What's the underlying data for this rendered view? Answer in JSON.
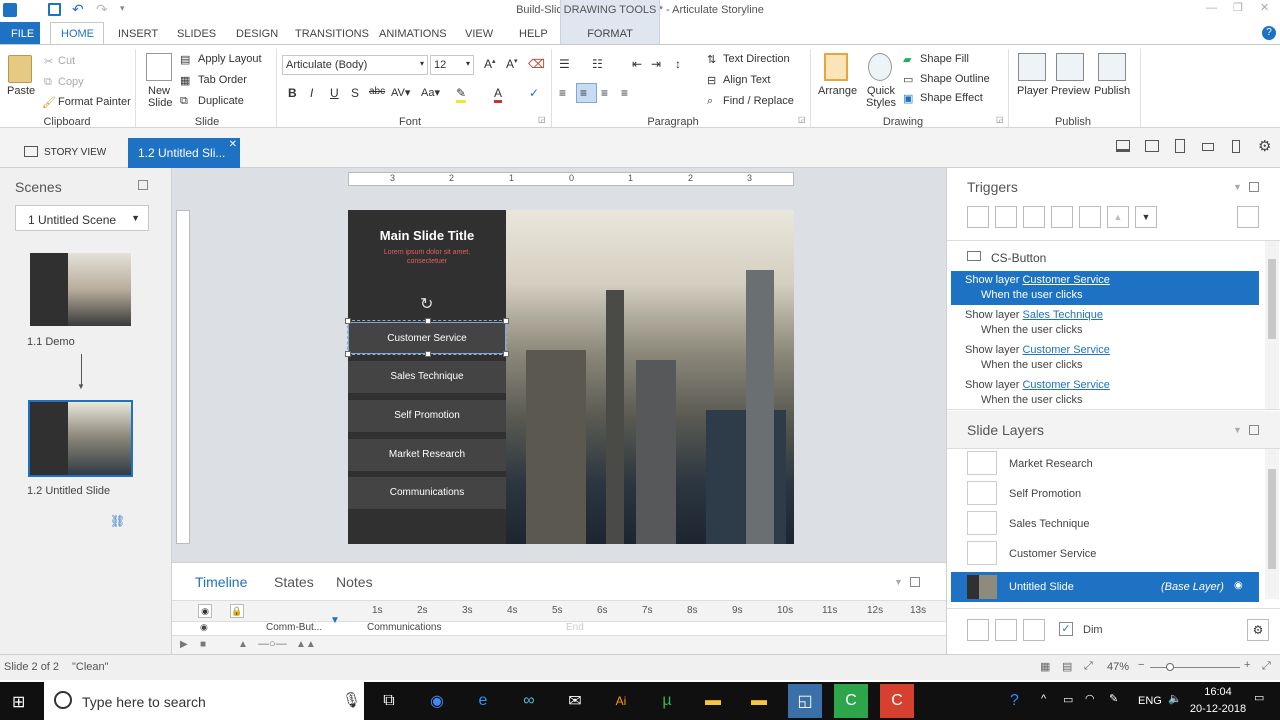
{
  "window": {
    "title": "Build-Slide-With-Trigger.story* - Articulate Storyline"
  },
  "drawing_tools": {
    "label": "DRAWING TOOLS",
    "format_tab": "FORMAT"
  },
  "tabs": {
    "file": "FILE",
    "home": "HOME",
    "insert": "INSERT",
    "slides": "SLIDES",
    "design": "DESIGN",
    "transitions": "TRANSITIONS",
    "animations": "ANIMATIONS",
    "view": "VIEW",
    "help": "HELP"
  },
  "ribbon": {
    "clipboard": {
      "paste": "Paste",
      "cut": "Cut",
      "copy": "Copy",
      "format_painter": "Format Painter",
      "group": "Clipboard"
    },
    "slide": {
      "new_slide": "New Slide",
      "apply_layout": "Apply Layout",
      "tab_order": "Tab Order",
      "duplicate": "Duplicate",
      "group": "Slide"
    },
    "font": {
      "family": "Articulate (Body)",
      "size": "12",
      "group": "Font"
    },
    "paragraph": {
      "text_direction": "Text Direction",
      "align_text": "Align Text",
      "find_replace": "Find / Replace",
      "group": "Paragraph"
    },
    "drawing": {
      "arrange": "Arrange",
      "quick_styles": "Quick Styles",
      "shape_fill": "Shape Fill",
      "shape_outline": "Shape Outline",
      "shape_effect": "Shape Effect",
      "group": "Drawing"
    },
    "publish": {
      "player": "Player",
      "preview": "Preview",
      "publish": "Publish",
      "group": "Publish"
    }
  },
  "viewtabs": {
    "story_view": "STORY VIEW",
    "slide_tab": "1.2 Untitled Sli..."
  },
  "scenes": {
    "title": "Scenes",
    "dropdown": "1 Untitled Scene",
    "items": [
      {
        "label": "1.1 Demo"
      },
      {
        "label": "1.2 Untitled Slide"
      }
    ]
  },
  "slide": {
    "title": "Main Slide Title",
    "subtitle": "Lorem ipsum dolor sit amet, consectetuer",
    "buttons": [
      "Customer Service",
      "Sales Technique",
      "Self Promotion",
      "Market Research",
      "Communications"
    ]
  },
  "ruler": {
    "labels": [
      "3",
      "2",
      "1",
      "0",
      "1",
      "2",
      "3"
    ]
  },
  "timeline": {
    "tabs": [
      "Timeline",
      "States",
      "Notes"
    ],
    "ticks": [
      "1s",
      "2s",
      "3s",
      "4s",
      "5s",
      "6s",
      "7s",
      "8s",
      "9s",
      "10s",
      "11s",
      "12s",
      "13s"
    ],
    "row_name": "Comm-But...",
    "row_bar": "Communications",
    "row_end": "End"
  },
  "triggers": {
    "title": "Triggers",
    "object": "CS-Button",
    "rows": [
      {
        "action": "Show layer",
        "target": "Customer Service",
        "when": "When the user clicks",
        "selected": true
      },
      {
        "action": "Show layer",
        "target": "Sales Technique",
        "when": "When the user clicks",
        "selected": false
      },
      {
        "action": "Show layer",
        "target": "Customer Service",
        "when": "When the user clicks",
        "selected": false
      },
      {
        "action": "Show layer",
        "target": "Customer Service",
        "when": "When the user clicks",
        "selected": false
      }
    ]
  },
  "layers": {
    "title": "Slide Layers",
    "items": [
      "Market Research",
      "Self Promotion",
      "Sales Technique",
      "Customer Service"
    ],
    "base": {
      "name": "Untitled Slide",
      "tag": "(Base Layer)"
    },
    "dim": "Dim"
  },
  "status": {
    "slide": "Slide 2 of 2",
    "theme": "\"Clean\"",
    "zoom": "47%"
  },
  "taskbar": {
    "search_placeholder": "Type here to search",
    "lang": "ENG",
    "time": "16:04",
    "date": "20-12-2018"
  },
  "colors": {
    "accent": "#1e72c4",
    "slide_panel": "#303030",
    "button": "#444444"
  }
}
